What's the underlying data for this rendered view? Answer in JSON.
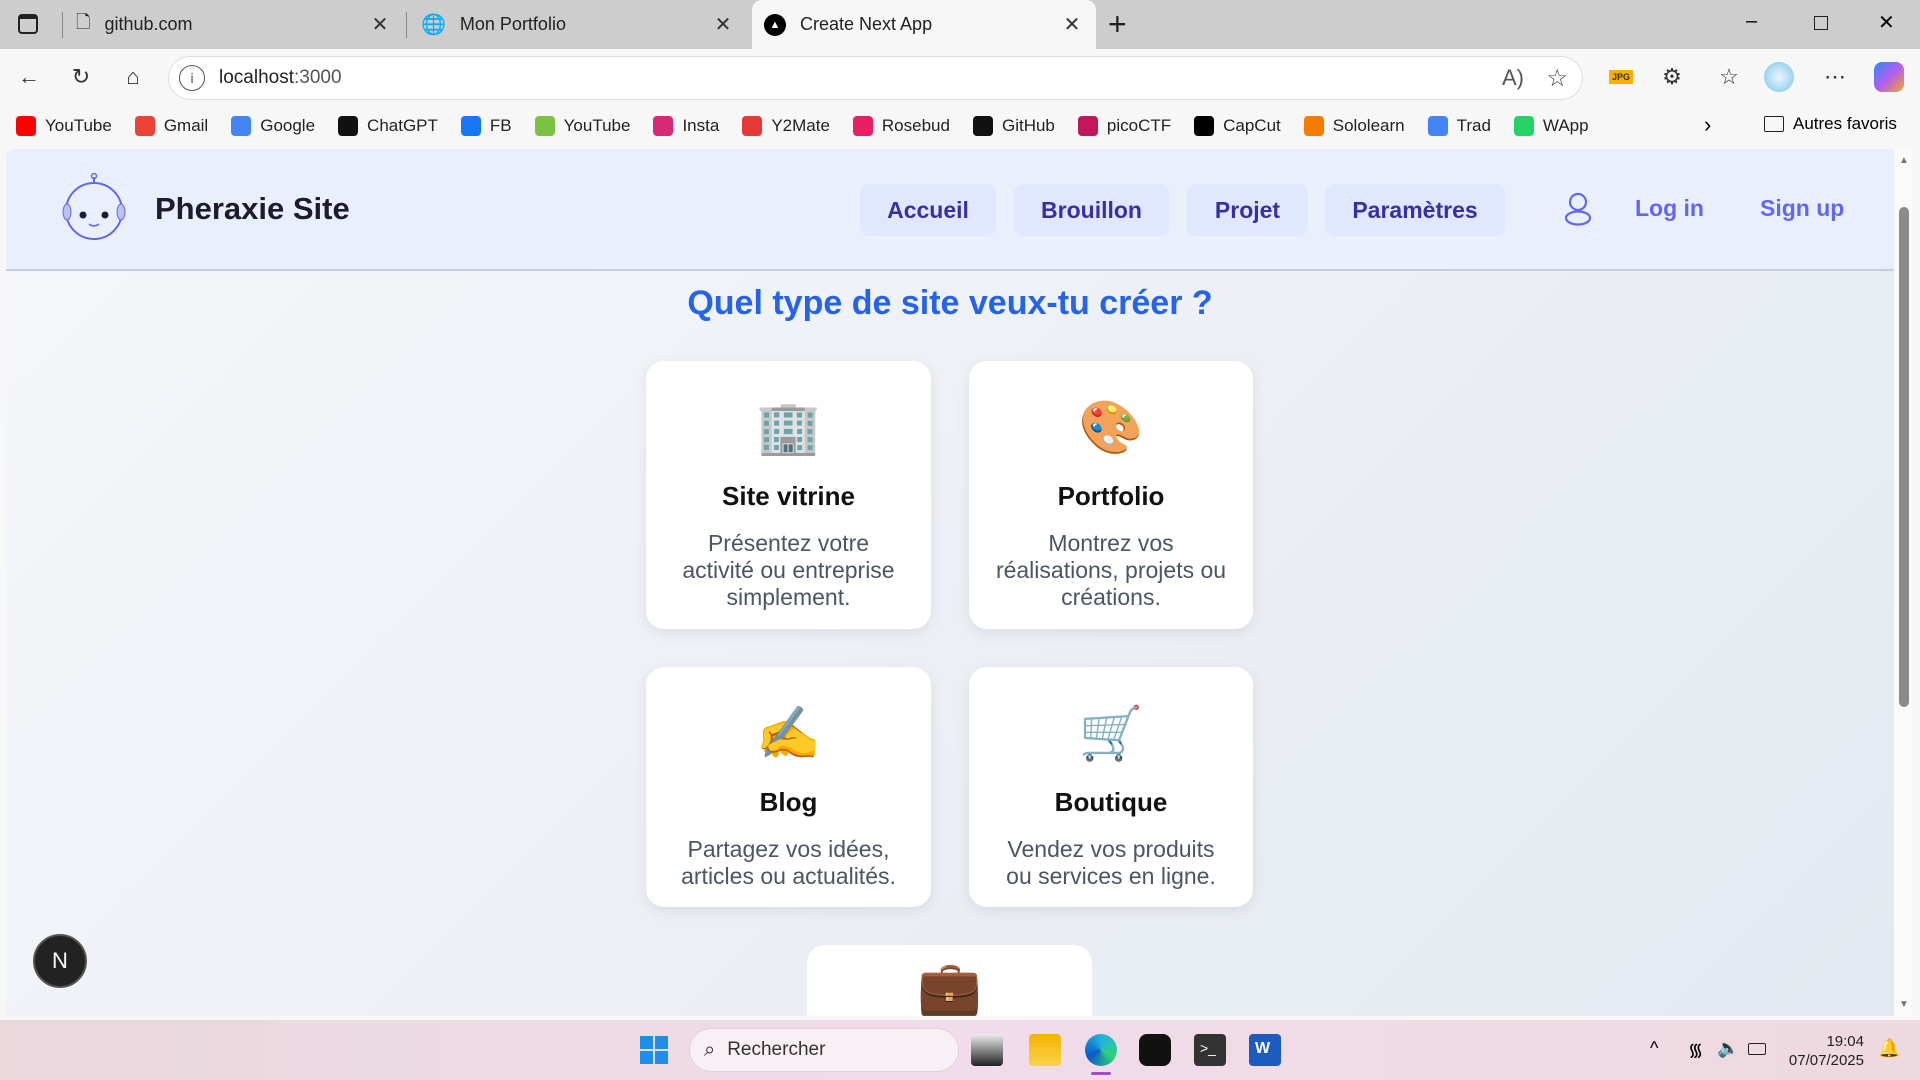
{
  "browser": {
    "tabs": [
      {
        "label": "github.com"
      },
      {
        "label": "Mon Portfolio"
      },
      {
        "label": "Create Next App",
        "active": true
      }
    ],
    "url_host": "localhost",
    "url_port": ":3000",
    "bookmarks": [
      {
        "label": "YouTube",
        "color": "#ff0000"
      },
      {
        "label": "Gmail",
        "color": "#ea4335"
      },
      {
        "label": "Google",
        "color": "#4285f4"
      },
      {
        "label": "ChatGPT",
        "color": "#111111"
      },
      {
        "label": "FB",
        "color": "#1877f2"
      },
      {
        "label": "YouTube",
        "color": "#7cc242"
      },
      {
        "label": "Insta",
        "color": "#d62976"
      },
      {
        "label": "Y2Mate",
        "color": "#e53935"
      },
      {
        "label": "Rosebud",
        "color": "#e91e63"
      },
      {
        "label": "GitHub",
        "color": "#111111"
      },
      {
        "label": "picoCTF",
        "color": "#c2185b"
      },
      {
        "label": "CapCut",
        "color": "#000000"
      },
      {
        "label": "Sololearn",
        "color": "#f57c00"
      },
      {
        "label": "Trad",
        "color": "#4285f4"
      },
      {
        "label": "WApp",
        "color": "#25d366"
      }
    ],
    "other_favorites": "Autres favoris",
    "ext_jpg": "JPG"
  },
  "site": {
    "title": "Pheraxie Site",
    "nav": [
      "Accueil",
      "Brouillon",
      "Projet",
      "Paramètres"
    ],
    "login": "Log in",
    "signup": "Sign up",
    "heading": "Quel type de site veux-tu créer ?",
    "cards": [
      {
        "emoji": "🏢",
        "title": "Site vitrine",
        "desc": "Présentez votre activité ou entreprise simplement."
      },
      {
        "emoji": "🎨",
        "title": "Portfolio",
        "desc": "Montrez vos réalisations, projets ou créations."
      },
      {
        "emoji": "✍️",
        "title": "Blog",
        "desc": "Partagez vos idées, articles ou actualités."
      },
      {
        "emoji": "🛒",
        "title": "Boutique",
        "desc": "Vendez vos produits ou services en ligne."
      },
      {
        "emoji": "💼"
      }
    ],
    "next_badge": "N"
  },
  "taskbar": {
    "search": "Rechercher",
    "time": "19:04",
    "date": "07/07/2025"
  }
}
